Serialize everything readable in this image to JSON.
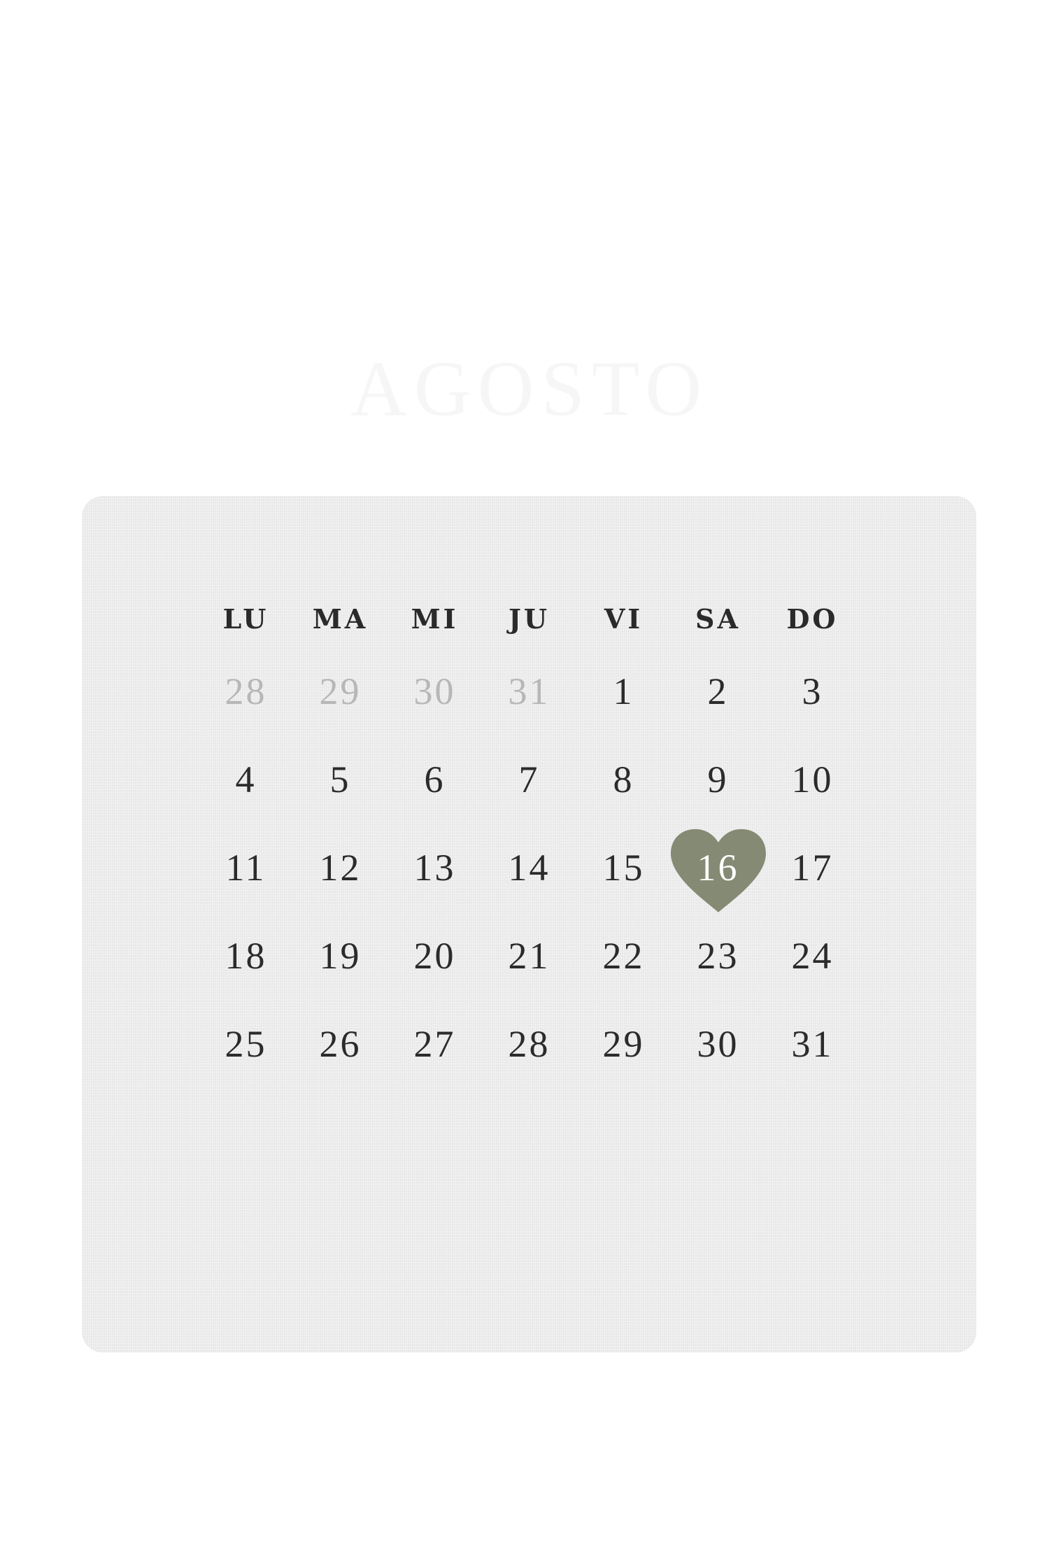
{
  "calendar": {
    "month": "AGOSTO",
    "weekdays": [
      "LU",
      "MA",
      "MI",
      "JU",
      "VI",
      "SA",
      "DO"
    ],
    "weeks": [
      [
        "28",
        "29",
        "30",
        "31",
        "1",
        "2",
        "3"
      ],
      [
        "4",
        "5",
        "6",
        "7",
        "8",
        "9",
        "10"
      ],
      [
        "11",
        "12",
        "13",
        "14",
        "15",
        "16",
        "17"
      ],
      [
        "18",
        "19",
        "20",
        "21",
        "22",
        "23",
        "24"
      ],
      [
        "25",
        "26",
        "27",
        "28",
        "29",
        "30",
        "31"
      ]
    ],
    "highlighted_day": "16",
    "colors": {
      "heart": "#858a74",
      "text": "#2b2b2b",
      "muted_text": "#b7b7b7",
      "card": "#ededee"
    }
  }
}
